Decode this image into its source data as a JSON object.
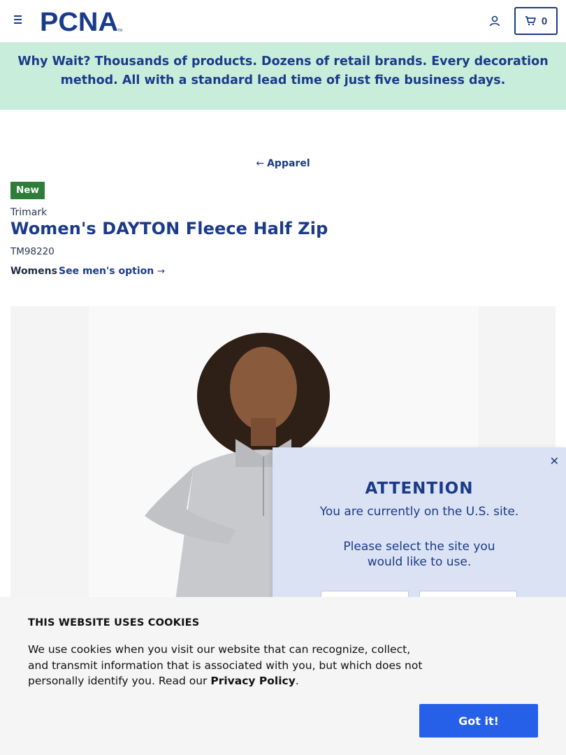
{
  "header": {
    "logo_text": "PCNA",
    "cart_count": "0",
    "brand_color": "#1a3a8a"
  },
  "promo": {
    "lead": "Why Wait?",
    "text": " Thousands of products. Dozens of retail brands. Every decoration method. All with a standard lead time of just five business days."
  },
  "breadcrumb": {
    "back_label": "Apparel"
  },
  "product": {
    "badge": "New",
    "brand": "Trimark",
    "title": "Women's DAYTON Fleece Half Zip",
    "sku": "TM98220",
    "gender": "Womens",
    "alt_link": "See men's option"
  },
  "attention": {
    "heading": "ATTENTION",
    "line1": "You are currently on the U.S. site.",
    "line2": "Please select the site you would like to use."
  },
  "cookie": {
    "heading": "THIS WEBSITE USES COOKIES",
    "body": "We use cookies when you visit our website that can recognize, collect, and transmit information that is associated with you, but which does not personally identify you. Read our ",
    "policy_link": "Privacy Policy",
    "period": ".",
    "button": "Got it!",
    "button_color": "#2660e8"
  }
}
